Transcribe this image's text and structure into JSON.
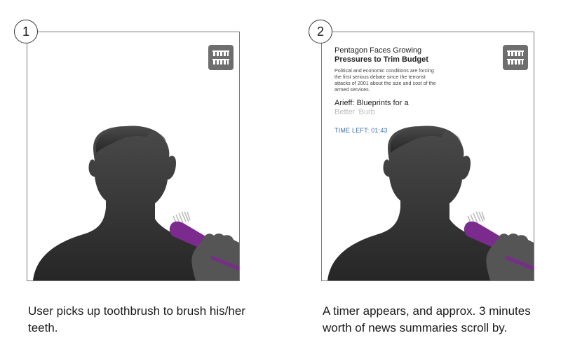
{
  "panels": [
    {
      "step": "1",
      "caption": "User picks up toothbrush to brush his/her teeth."
    },
    {
      "step": "2",
      "caption": "A timer appears, and approx. 3 minutes worth of news summaries scroll by.",
      "news": {
        "headline1_line1": "Pentagon Faces Growing",
        "headline1_line2": "Pressures to Trim Budget",
        "summary": "Political and economic conditions are forcing the first serious debate since the terrorist attacks of 2001 about the size and cost of the armed services.",
        "headline2_line1": "Arieff: Blueprints for a",
        "headline2_line2": "Better 'Burb",
        "timer": "TIME LEFT: 01:43"
      }
    }
  ],
  "colors": {
    "toothbrush": "#7b2a8e",
    "silhouette": "#3a3a3a",
    "hand": "#555555",
    "timer": "#3d6fa8"
  },
  "icons": [
    "toothbrush-holder-icon",
    "person-silhouette",
    "hand-with-toothbrush"
  ]
}
